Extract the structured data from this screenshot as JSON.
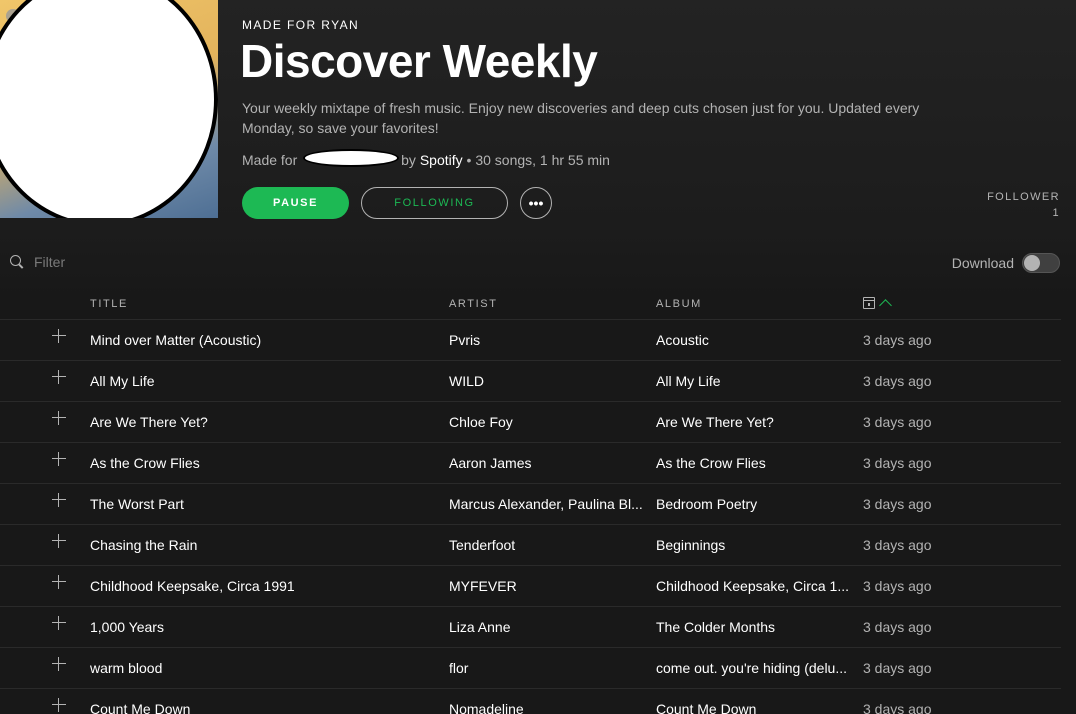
{
  "header": {
    "made_for": "MADE FOR RYAN",
    "title": "Discover Weekly",
    "description": "Your weekly mixtape of fresh music. Enjoy new discoveries and deep cuts chosen just for you. Updated every Monday, so save your favorites!",
    "byline_prefix": "Made for",
    "byline_by": "by",
    "owner": "Spotify",
    "byline_stats": "• 30 songs, 1 hr 55 min",
    "pause_label": "PAUSE",
    "following_label": "FOLLOWING",
    "more_label": "•••",
    "followers_label": "FOLLOWER",
    "followers_count": "1"
  },
  "filter": {
    "placeholder": "Filter"
  },
  "download": {
    "label": "Download",
    "enabled": false
  },
  "table": {
    "columns": {
      "title": "TITLE",
      "artist": "ARTIST",
      "album": "ALBUM"
    },
    "rows": [
      {
        "title": "Mind over Matter (Acoustic)",
        "artist": "Pvris",
        "album": "Acoustic",
        "added": "3 days ago"
      },
      {
        "title": "All My Life",
        "artist": "WILD",
        "album": "All My Life",
        "added": "3 days ago"
      },
      {
        "title": "Are We There Yet?",
        "artist": "Chloe Foy",
        "album": "Are We There Yet?",
        "added": "3 days ago"
      },
      {
        "title": "As the Crow Flies",
        "artist": "Aaron James",
        "album": "As the Crow Flies",
        "added": "3 days ago"
      },
      {
        "title": "The Worst Part",
        "artist": "Marcus Alexander, Paulina Bl...",
        "album": "Bedroom Poetry",
        "added": "3 days ago"
      },
      {
        "title": "Chasing the Rain",
        "artist": "Tenderfoot",
        "album": "Beginnings",
        "added": "3 days ago"
      },
      {
        "title": "Childhood Keepsake, Circa 1991",
        "artist": "MYFEVER",
        "album": "Childhood Keepsake, Circa 1...",
        "added": "3 days ago"
      },
      {
        "title": "1,000 Years",
        "artist": "Liza Anne",
        "album": "The Colder Months",
        "added": "3 days ago"
      },
      {
        "title": "warm blood",
        "artist": "flor",
        "album": "come out. you're hiding (delu...",
        "added": "3 days ago"
      },
      {
        "title": "Count Me Down",
        "artist": "Nomadeline",
        "album": "Count Me Down",
        "added": "3 days ago"
      }
    ]
  },
  "colors": {
    "accent": "#1db954",
    "background": "#181818",
    "text_primary": "#ffffff",
    "text_secondary": "#b3b3b3"
  }
}
